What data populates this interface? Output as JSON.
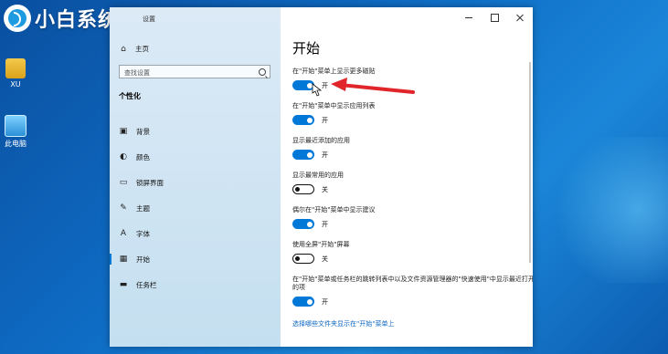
{
  "desktop": {
    "brand": "小白系统",
    "icons": [
      {
        "label": "XU",
        "icon": "user-folder-icon"
      },
      {
        "label": "此电脑",
        "icon": "this-pc-icon"
      }
    ]
  },
  "window": {
    "title": "设置",
    "sidebar": {
      "home_label": "主页",
      "search_placeholder": "查找设置",
      "heading": "个性化",
      "items": [
        {
          "label": "背景",
          "icon": "image-icon"
        },
        {
          "label": "颜色",
          "icon": "palette-icon"
        },
        {
          "label": "锁屏界面",
          "icon": "lock-screen-icon"
        },
        {
          "label": "主题",
          "icon": "theme-brush-icon"
        },
        {
          "label": "字体",
          "icon": "font-icon"
        },
        {
          "label": "开始",
          "icon": "start-icon",
          "active": true
        },
        {
          "label": "任务栏",
          "icon": "taskbar-icon"
        }
      ]
    },
    "content": {
      "page_title": "开始",
      "settings": [
        {
          "label": "在\"开始\"菜单上显示更多磁贴",
          "state": "开",
          "on": true
        },
        {
          "label": "在\"开始\"菜单中显示应用列表",
          "state": "开",
          "on": true
        },
        {
          "label": "显示最近添加的应用",
          "state": "开",
          "on": true
        },
        {
          "label": "显示最常用的应用",
          "state": "关",
          "on": false
        },
        {
          "label": "偶尔在\"开始\"菜单中显示建议",
          "state": "开",
          "on": true
        },
        {
          "label": "使用全屏\"开始\"屏幕",
          "state": "关",
          "on": false
        },
        {
          "label": "在\"开始\"菜单或任务栏的跳转列表中以及文件资源管理器的\"快速使用\"中显示最近打开的项",
          "state": "开",
          "on": true
        }
      ],
      "link": "选择哪些文件夹显示在\"开始\"菜单上"
    }
  },
  "colors": {
    "accent": "#0078d7",
    "annotation": "#e0262b"
  }
}
